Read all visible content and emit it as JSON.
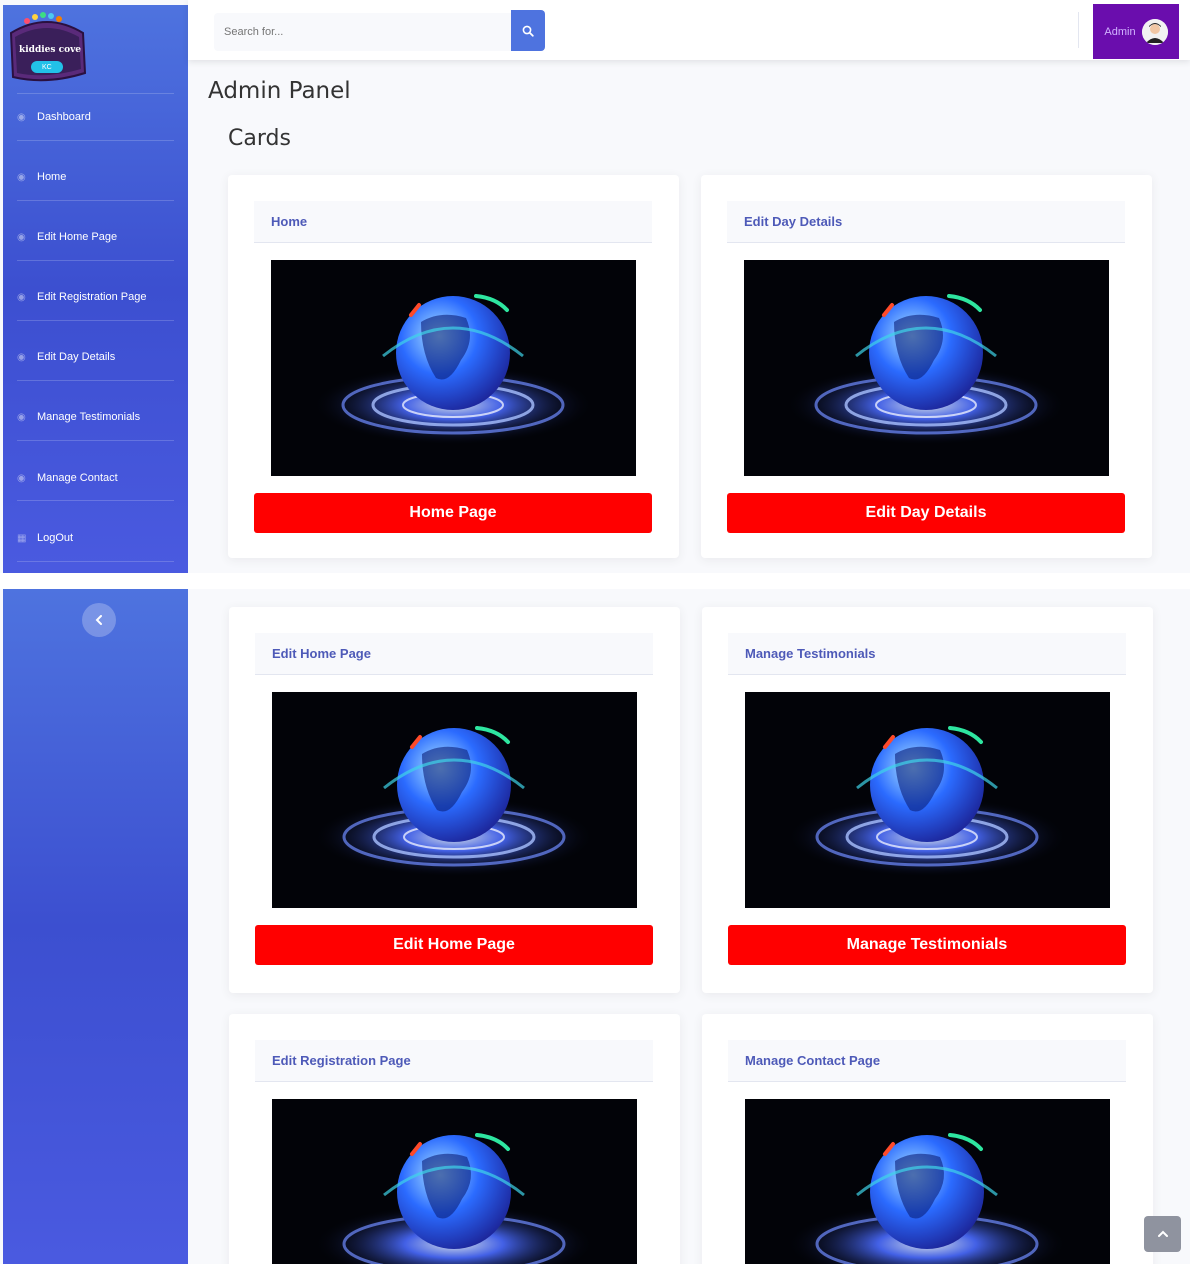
{
  "brand": {
    "logo_text": "kiddies cove",
    "logo_sub": "KC"
  },
  "sidebar": {
    "items": [
      {
        "label": "Dashboard",
        "icon": "dashboard-icon"
      },
      {
        "label": "Home",
        "icon": "dashboard-icon"
      },
      {
        "label": "Edit Home Page",
        "icon": "dashboard-icon"
      },
      {
        "label": "Edit Registration Page",
        "icon": "dashboard-icon"
      },
      {
        "label": "Edit Day Details",
        "icon": "dashboard-icon"
      },
      {
        "label": "Manage Testimonials",
        "icon": "dashboard-icon"
      },
      {
        "label": "Manage Contact",
        "icon": "dashboard-icon"
      },
      {
        "label": "LogOut",
        "icon": "table-icon"
      }
    ],
    "toggle_icon": "chevron-left-icon"
  },
  "search": {
    "placeholder": "Search for...",
    "icon": "search-icon"
  },
  "user": {
    "name": "Admin",
    "avatar_icon": "user-avatar"
  },
  "page": {
    "title": "Admin Panel",
    "section": "Cards"
  },
  "cards": [
    {
      "header": "Home",
      "button": "Home Page"
    },
    {
      "header": "Edit Day Details",
      "button": "Edit Day Details"
    },
    {
      "header": "Edit Home Page",
      "button": "Edit Home Page"
    },
    {
      "header": "Manage Testimonials",
      "button": "Manage Testimonials"
    },
    {
      "header": "Edit Registration Page",
      "button": ""
    },
    {
      "header": "Manage Contact Page",
      "button": ""
    }
  ],
  "scroll_top_icon": "chevron-up-icon",
  "colors": {
    "sidebar": "#4e73df",
    "button": "#ff0000",
    "user_box": "#6a0dad",
    "card_header_text": "#4e5ab8"
  }
}
